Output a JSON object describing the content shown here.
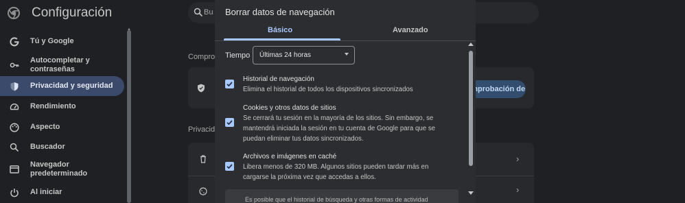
{
  "app": {
    "title": "Configuración",
    "search_placeholder": "Buscar en la configuración"
  },
  "sidebar": {
    "items": [
      {
        "label": "Tú y Google",
        "icon": "google-icon",
        "active": false
      },
      {
        "label": "Autocompletar y contraseñas",
        "icon": "key-icon",
        "active": false
      },
      {
        "label": "Privacidad y seguridad",
        "icon": "shield-icon",
        "active": true
      },
      {
        "label": "Rendimiento",
        "icon": "speedometer-icon",
        "active": false
      },
      {
        "label": "Aspecto",
        "icon": "palette-icon",
        "active": false
      },
      {
        "label": "Buscador",
        "icon": "search-icon",
        "active": false
      },
      {
        "label": "Navegador predeterminado",
        "icon": "browser-icon",
        "active": false
      },
      {
        "label": "Al iniciar",
        "icon": "power-icon",
        "active": false
      }
    ]
  },
  "main": {
    "section_safety": "Comprobación de seguridad",
    "section_privacy": "Privacidad y seguridad",
    "safety_button": "Ir a Comprobación de seguridad"
  },
  "dialog": {
    "title": "Borrar datos de navegación",
    "tabs": [
      {
        "label": "Básico",
        "selected": true
      },
      {
        "label": "Avanzado",
        "selected": false
      }
    ],
    "time_range": {
      "label": "Tiempo",
      "value": "Últimas 24 horas"
    },
    "options": [
      {
        "title": "Historial de navegación",
        "description": "Elimina el historial de todos los dispositivos sincronizados",
        "checked": true
      },
      {
        "title": "Cookies y otros datos de sitios",
        "description": "Se cerrará tu sesión en la mayoría de los sitios. Sin embargo, se mantendrá iniciada la sesión en tu cuenta de Google para que se puedan eliminar tus datos sincronizados.",
        "checked": true
      },
      {
        "title": "Archivos e imágenes en caché",
        "description": "Libera menos de 320 MB. Algunos sitios pueden tardar más en cargarse la próxima vez que accedas a ellos.",
        "checked": true
      }
    ],
    "info_text": "Es posible que el historial de búsqueda y otras formas de actividad"
  },
  "colors": {
    "accent": "#a8c7fa",
    "background": "#1f2023",
    "dialog": "#2c2d30",
    "active_nav": "#3b4a6b"
  }
}
